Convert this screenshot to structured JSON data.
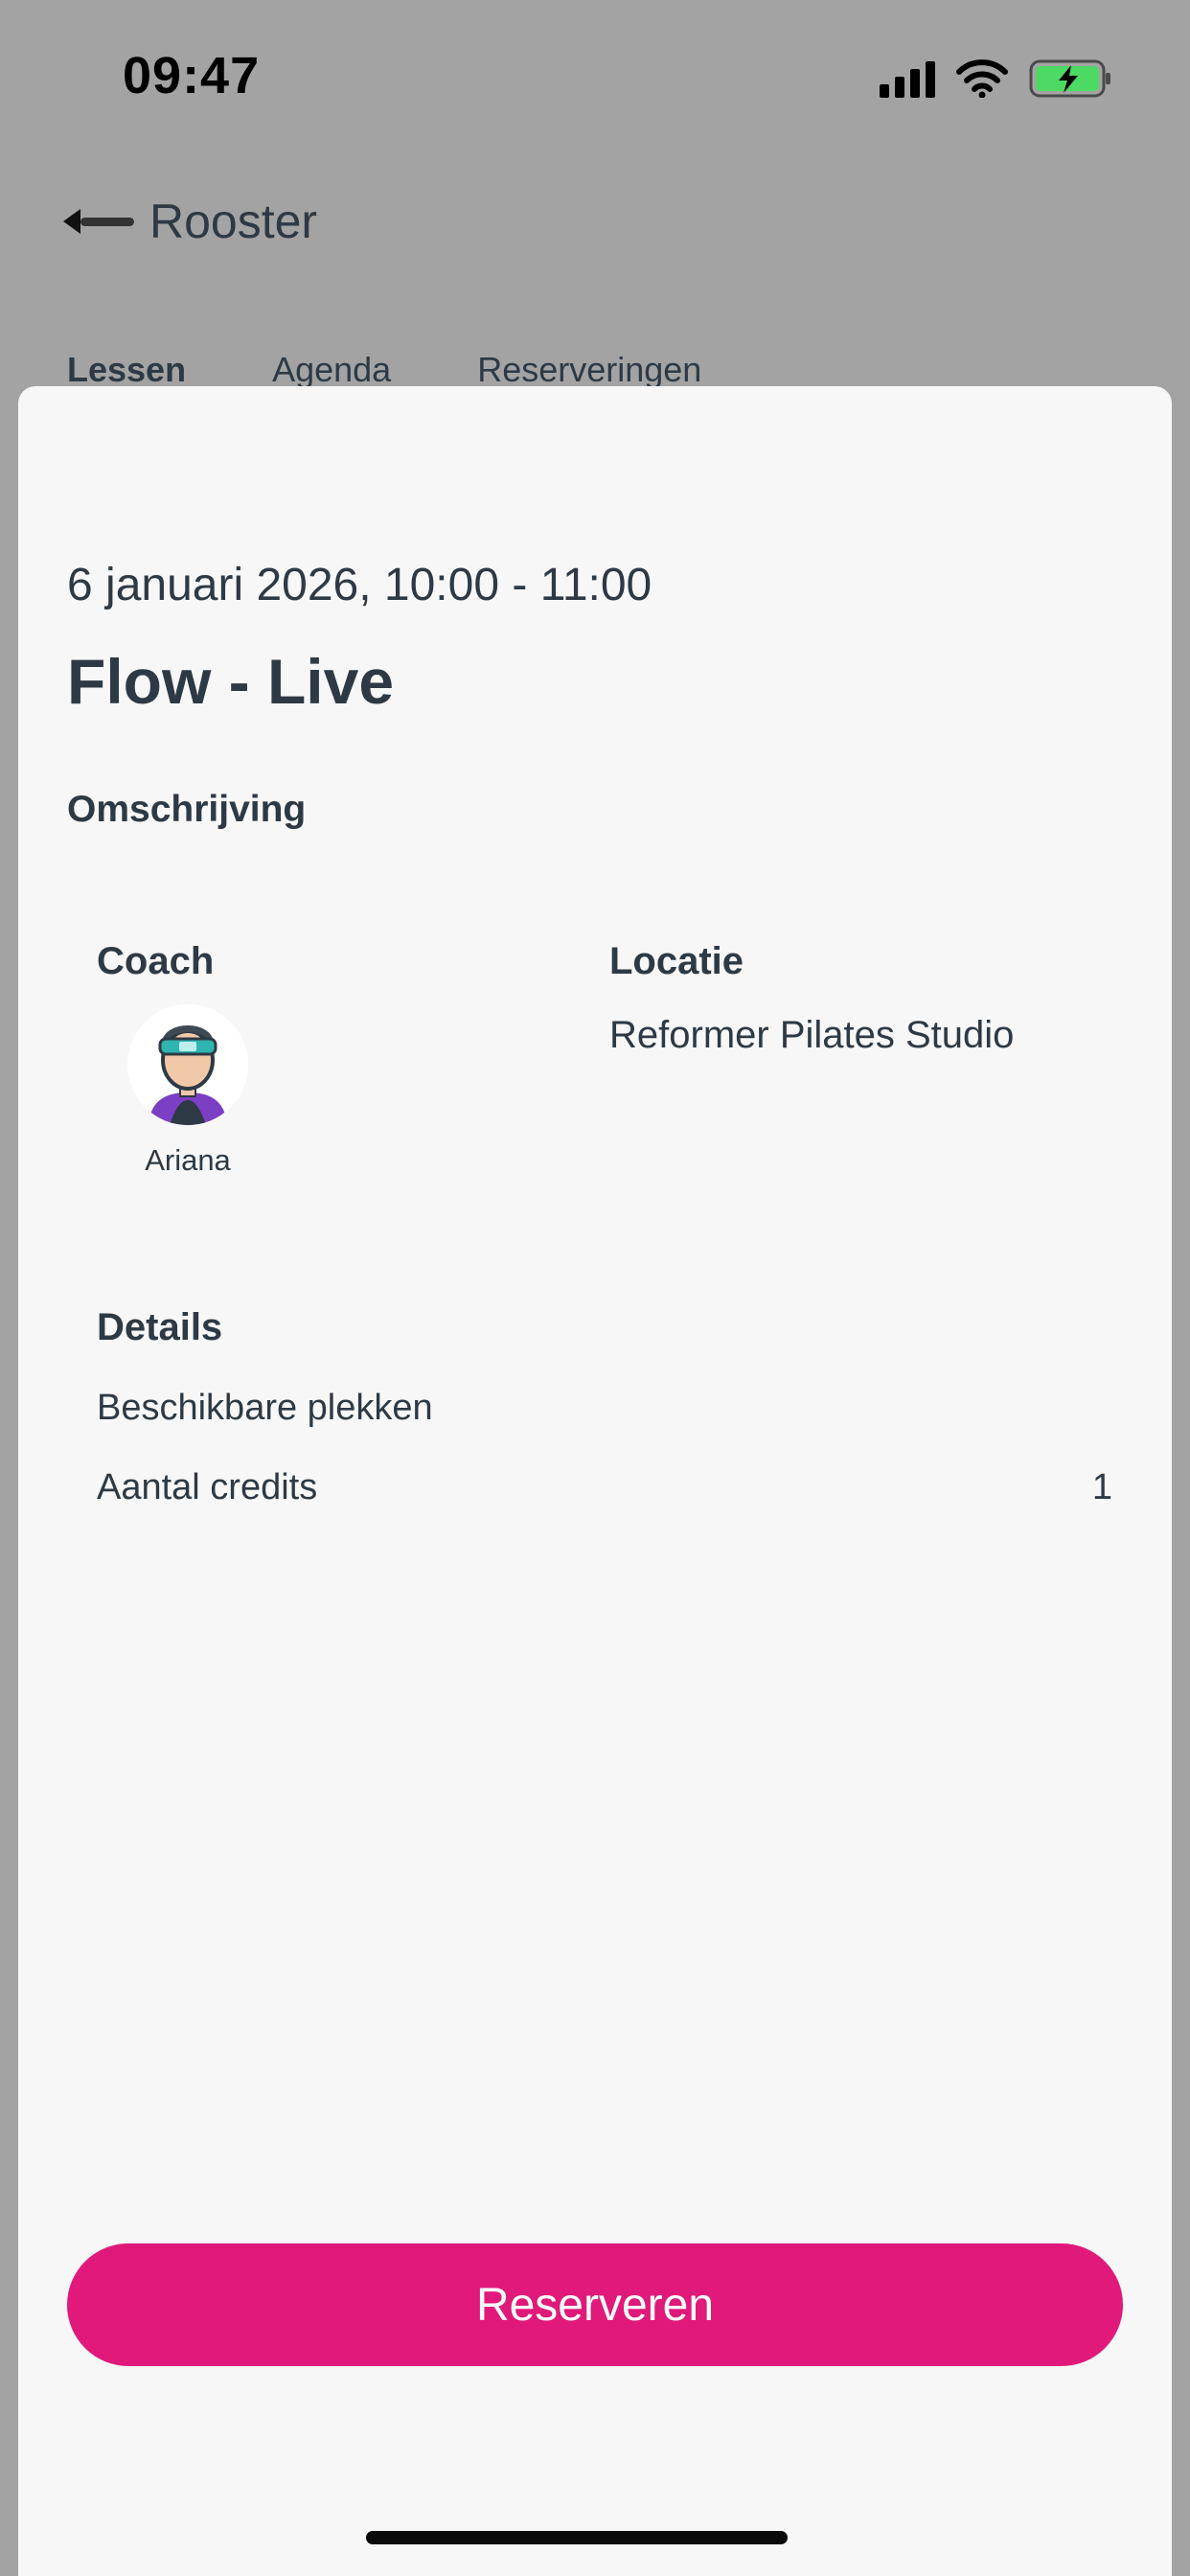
{
  "status_bar": {
    "time": "09:47",
    "icons": [
      "cellular-signal-icon",
      "wifi-icon",
      "battery-charging-icon"
    ],
    "battery_color": "#4cd964"
  },
  "header": {
    "back_icon": "back-arrow-icon",
    "title": "Rooster"
  },
  "tabs": [
    {
      "label": "Lessen",
      "active": true
    },
    {
      "label": "Agenda",
      "active": false
    },
    {
      "label": "Reserveringen",
      "active": false
    }
  ],
  "lesson": {
    "datetime": "6 januari 2026, 10:00 - 11:00",
    "title": "Flow - Live",
    "description_label": "Omschrijving",
    "coach_label": "Coach",
    "coach_name": "Ariana",
    "coach_avatar_icon": "coach-avatar-icon",
    "location_label": "Locatie",
    "location": "Reformer Pilates Studio",
    "details_label": "Details",
    "details": [
      {
        "label": "Beschikbare plekken",
        "value": ""
      },
      {
        "label": "Aantal credits",
        "value": "1"
      }
    ]
  },
  "actions": {
    "reserve_label": "Reserveren",
    "reserve_color": "#e0197a"
  },
  "colors": {
    "text_primary": "#2d3a45",
    "sheet_background": "#f7f7f7",
    "overlay_background": "#a3a3a3"
  }
}
